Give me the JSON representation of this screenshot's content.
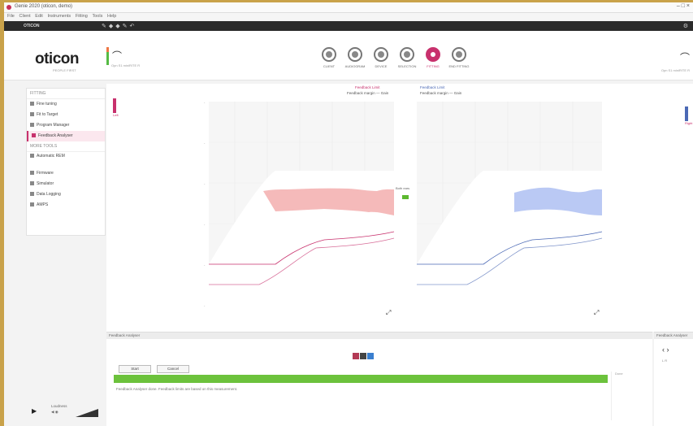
{
  "window": {
    "title": "Genie 2020 (oticon, demo)",
    "menu": [
      "File",
      "Client",
      "Edit",
      "Instruments",
      "Fitting",
      "Tools",
      "Help"
    ],
    "controls": "– □ ×"
  },
  "toolbar": {
    "label": "OTICON"
  },
  "header": {
    "logo": "oticon",
    "logo_sub": "PEOPLE FIRST",
    "device_label": "Opn S1 miniRITE R",
    "steps": [
      {
        "label": "CLIENT"
      },
      {
        "label": "AUDIOGRAM"
      },
      {
        "label": "DEVICE"
      },
      {
        "label": "SELECTION"
      },
      {
        "label": "FITTING"
      },
      {
        "label": "END FITTING"
      }
    ],
    "active_step": "FITTING",
    "right_label": "Opn S1 miniRITE R"
  },
  "sidebar": {
    "section1": "FITTING",
    "items1": [
      {
        "label": "Fine tuning"
      },
      {
        "label": "Fit to Target"
      },
      {
        "label": "Program Manager"
      },
      {
        "label": "Feedback Analyser"
      }
    ],
    "section2": "MORE TOOLS",
    "items2": [
      {
        "label": "Automatic REM"
      },
      {
        "label": "Firmware"
      },
      {
        "label": "Simulator"
      },
      {
        "label": "Data Logging"
      },
      {
        "label": "AMPS"
      }
    ]
  },
  "charts": {
    "left_title": "Feedback Limit",
    "left_sub": "Feedback margin — Gain",
    "right_title": "Feedback Limit",
    "right_sub": "Feedback margin — Gain",
    "left_gauge_label": "Left",
    "right_gauge_label": "Right",
    "mid_label": "Both ears",
    "left_color": "#c8316d",
    "right_color": "#4b69b5"
  },
  "bottom": {
    "header": "Feedback Analyser",
    "swatch_colors": [
      "#b33a55",
      "#444444",
      "#3a7fcf"
    ],
    "btn_start": "Start",
    "btn_cancel": "Cancel",
    "progress_pct": 100,
    "message": "Feedback Analyser done. Feedback limits are based on this measurement.",
    "side_label": "Done"
  },
  "right_panel": {
    "header": "Feedback Analyser",
    "nav": "‹ ›",
    "label": "L  R"
  },
  "footer": {
    "label": "Loudness",
    "icons": "◀ ◉"
  }
}
